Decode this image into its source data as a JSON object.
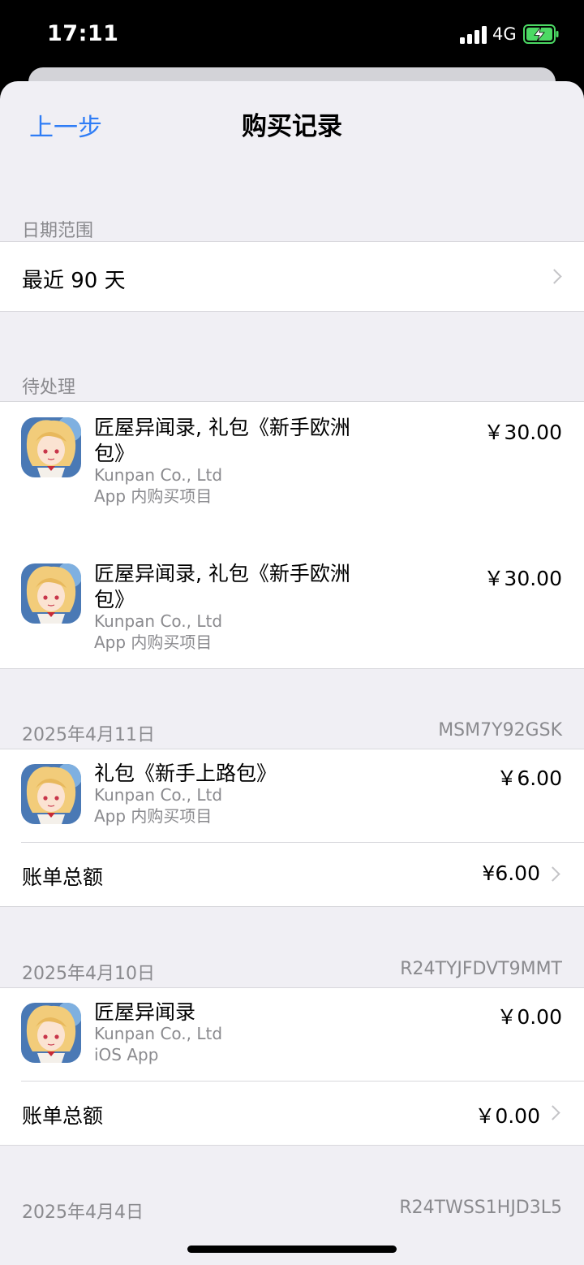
{
  "status": {
    "time": "17:11",
    "network": "4G",
    "colors": {
      "battery": "#4cd964"
    }
  },
  "nav": {
    "back_label": "上一步",
    "title": "购买记录",
    "accent": "#2f7df6"
  },
  "date_range": {
    "section_label": "日期范围",
    "value": "最近 90 天"
  },
  "pending": {
    "section_label": "待处理",
    "items": [
      {
        "title": "匠屋异闻录, 礼包《新手欧洲包》",
        "developer": "Kunpan Co., Ltd",
        "type": "App 内购买项目",
        "price": "￥30.00"
      },
      {
        "title": "匠屋异闻录, 礼包《新手欧洲包》",
        "developer": "Kunpan Co., Ltd",
        "type": "App 内购买项目",
        "price": "￥30.00"
      }
    ]
  },
  "orders": [
    {
      "date": "2025年4月11日",
      "order_id": "MSM7Y92GSK",
      "item": {
        "title": "礼包《新手上路包》",
        "developer": "Kunpan Co., Ltd",
        "type": "App 内购买项目",
        "price": "￥6.00"
      },
      "total_label": "账单总额",
      "total_value": "¥6.00"
    },
    {
      "date": "2025年4月10日",
      "order_id": "R24TYJFDVT9MMT",
      "item": {
        "title": "匠屋异闻录",
        "developer": "Kunpan Co., Ltd",
        "type": "iOS App",
        "price": "￥0.00"
      },
      "total_label": "账单总额",
      "total_value": "￥0.00"
    },
    {
      "date": "2025年4月4日",
      "order_id": "R24TWSS1HJD3L5"
    }
  ]
}
